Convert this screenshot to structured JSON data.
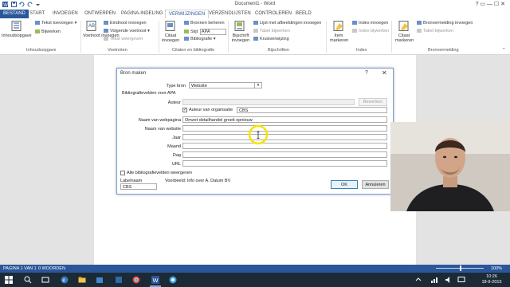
{
  "window": {
    "title": "Document1 - Word",
    "controls": "?   ▭   —   ☐   ✕"
  },
  "tabs": [
    {
      "label": "BESTAND"
    },
    {
      "label": "START"
    },
    {
      "label": "INVOEGEN"
    },
    {
      "label": "ONTWERPEN"
    },
    {
      "label": "PAGINA-INDELING"
    },
    {
      "label": "VERWIJZINGEN"
    },
    {
      "label": "VERZENDLIJSTEN"
    },
    {
      "label": "CONTROLEREN"
    },
    {
      "label": "BEELD"
    }
  ],
  "ribbon": {
    "toc": {
      "big": "Inhoudsopgave",
      "items": [
        "Tekst toevoegen ▾",
        "Bijwerken"
      ],
      "group": "Inhoudsopgave"
    },
    "footnotes": {
      "big": "Voetnoot invoegen",
      "items": [
        "Eindnoot invoegen",
        "Volgende voetnoot ▾",
        "Tekst weergeven"
      ],
      "group": "Voetnoten"
    },
    "citations": {
      "big": "Citaat invoegen",
      "items": [
        "Bronnen beheren",
        "Stijl:",
        "APA",
        "Bibliografie ▾"
      ],
      "group": "Citaten en bibliografie"
    },
    "captions": {
      "big": "Bijschrift invoegen",
      "items": [
        "Lijst met afbeeldingen invoegen",
        "Tabel bijwerken",
        "Kruisverwijzing"
      ],
      "group": "Bijschriften"
    },
    "index": {
      "big": "Item markeren",
      "items": [
        "Index invoegen",
        "Index bijwerken"
      ],
      "group": "Index"
    },
    "toa": {
      "big": "Citaat markeren",
      "items": [
        "Bronvermelding invoegen",
        "Tabel bijwerken"
      ],
      "group": "Bronvermelding"
    }
  },
  "dialog": {
    "title": "Bron maken",
    "help": "?",
    "close": "✕",
    "source_type_label": "Type bron",
    "source_type_value": "Website",
    "fields_header": "Bibliografievelden voor APA",
    "author_label": "Auteur",
    "edit_button": "Bewerken",
    "corporate_checkbox_label": "Auteur van organisatie",
    "corporate_checked": "✓",
    "corporate_value": "CBS",
    "fields": [
      {
        "label": "Naam van webpagina",
        "value": "Omzet detailhandel groeit opnieuw"
      },
      {
        "label": "Naam van website",
        "value": ""
      },
      {
        "label": "Jaar",
        "value": ""
      },
      {
        "label": "Maand",
        "value": ""
      },
      {
        "label": "Dag",
        "value": ""
      },
      {
        "label": "URL",
        "value": ""
      }
    ],
    "show_all_label": "Alle bibliografievelden weergeven",
    "tag_label": "Labelnaam",
    "tag_value": "CBS",
    "example_text": "Voorbeeld: Info over A. Datum BV",
    "ok": "OK",
    "cancel": "Annuleren"
  },
  "statusbar": {
    "page": "PAGINA 1 VAN 1",
    "words": "0 WOORDEN",
    "zoom": "100%"
  },
  "taskbar": {
    "time": "10:26",
    "date": "18-9-2015"
  },
  "colors": {
    "accent": "#2b579a",
    "highlight": "#f5e400"
  }
}
